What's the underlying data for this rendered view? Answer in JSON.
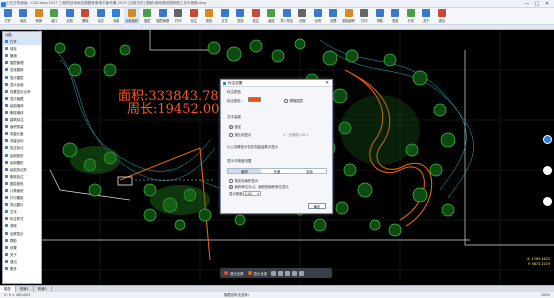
{
  "title_bar": {
    "title": "土石方快速版 - CAD.dwg 2017 工程项目场地总图园林景观平面布置 2019 [当前文件] 图纸\\场地规划园林施工总平面图.dwg",
    "minimize": "—",
    "maximize": "□",
    "close": "✕"
  },
  "ribbon": {
    "buttons": [
      {
        "label": "打开",
        "color": "#3a78c8"
      },
      {
        "label": "保存",
        "color": "#3a78c8"
      },
      {
        "label": "转换",
        "color": "#d48a1e"
      },
      {
        "label": "窗口",
        "color": "#4aa04a"
      },
      {
        "label": "比较",
        "color": "#3a78c8"
      },
      {
        "label": "删除",
        "color": "#c84a3a"
      },
      {
        "label": "合并",
        "color": "#3a78c8"
      },
      {
        "label": "测量",
        "color": "#2f7fe0"
      },
      {
        "label": "测量面积",
        "color": "#d48a1e"
      },
      {
        "label": "图层",
        "color": "#4aa04a"
      },
      {
        "label": "图层管理",
        "color": "#3a78c8"
      },
      {
        "label": "打印",
        "color": "#666666"
      },
      {
        "label": "标注",
        "color": "#c84a3a"
      },
      {
        "label": "颜色",
        "color": "#d48a1e"
      },
      {
        "label": "文字",
        "color": "#3a78c8"
      },
      {
        "label": "查找",
        "color": "#3a78c8"
      },
      {
        "label": "批注",
        "color": "#c84a3a"
      },
      {
        "label": "画线",
        "color": "#4aa04a"
      },
      {
        "label": "导入导出",
        "color": "#3a78c8"
      },
      {
        "label": "设置",
        "color": "#666666"
      },
      {
        "label": "比例",
        "color": "#3a78c8"
      },
      {
        "label": "全屏",
        "color": "#3a78c8"
      },
      {
        "label": "图幅面积",
        "color": "#d48a1e"
      },
      {
        "label": "打印",
        "color": "#666666"
      },
      {
        "label": "帮助",
        "color": "#3a78c8"
      },
      {
        "label": "登录",
        "color": "#3a78c8"
      },
      {
        "label": "分享",
        "color": "#4aa04a"
      },
      {
        "label": "关于",
        "color": "#3a78c8"
      },
      {
        "label": "退出",
        "color": "#c84a3a"
      }
    ],
    "active_index": 8
  },
  "left_panel": {
    "header": "功能",
    "items": [
      "打开",
      "保存",
      "撤销",
      "图层管理",
      "查找替换",
      "显示图层",
      "显示全部",
      "设置显示比例",
      "显示隐藏",
      "绘制墙体",
      "删除墙体",
      "建筑标注",
      "面积测量",
      "测量长度",
      "测量坐标",
      "批注标记",
      "绘制矩形",
      "绘制圆形",
      "绘制多边形",
      "删除批注",
      "图层颜色",
      "计算面积",
      "打印图纸",
      "导出图片",
      "文字",
      "标注样式",
      "清除",
      "全屏显示",
      "帮助",
      "设置",
      "关于",
      "退出",
      "更多"
    ]
  },
  "drawing": {
    "area_text": "面积:333843.78",
    "perimeter_text": "周长:19452.00"
  },
  "dialog": {
    "title": "标注设置",
    "close": "✕",
    "section_color": "标注颜色",
    "color_label": "标注颜色:",
    "swatch_color": "#e8530e",
    "follow_layer": "跟随图层",
    "section_text": "文字高度",
    "fixed": "固定",
    "by_scale": "按比例显示",
    "ratio_hint": "1 : 比例值 1/0.1",
    "note": "以上设置部分仅在测量结果中显示",
    "section_display": "显示与精度设置",
    "tabs": [
      "面积",
      "长度",
      "坐标"
    ],
    "active_tab": 0,
    "option1": "按实际面积显示",
    "option2": "面积单位为㎡，面积按面积单位显示",
    "precision_label": "显示精度:",
    "precision_value": "0.00",
    "ok": "确定"
  },
  "float_toolbar": {
    "items": [
      "退出全屏",
      "显示全部"
    ]
  },
  "coords": {
    "line1": "X: 1765.4622",
    "line2": "Y: 5873.2219"
  },
  "tabs": [
    "模型",
    "布局1",
    "布局2"
  ],
  "status": {
    "left": "0 : 0  ×  40/14/03",
    "middle": "隐藏选择(无选择)",
    "right": "100%"
  }
}
